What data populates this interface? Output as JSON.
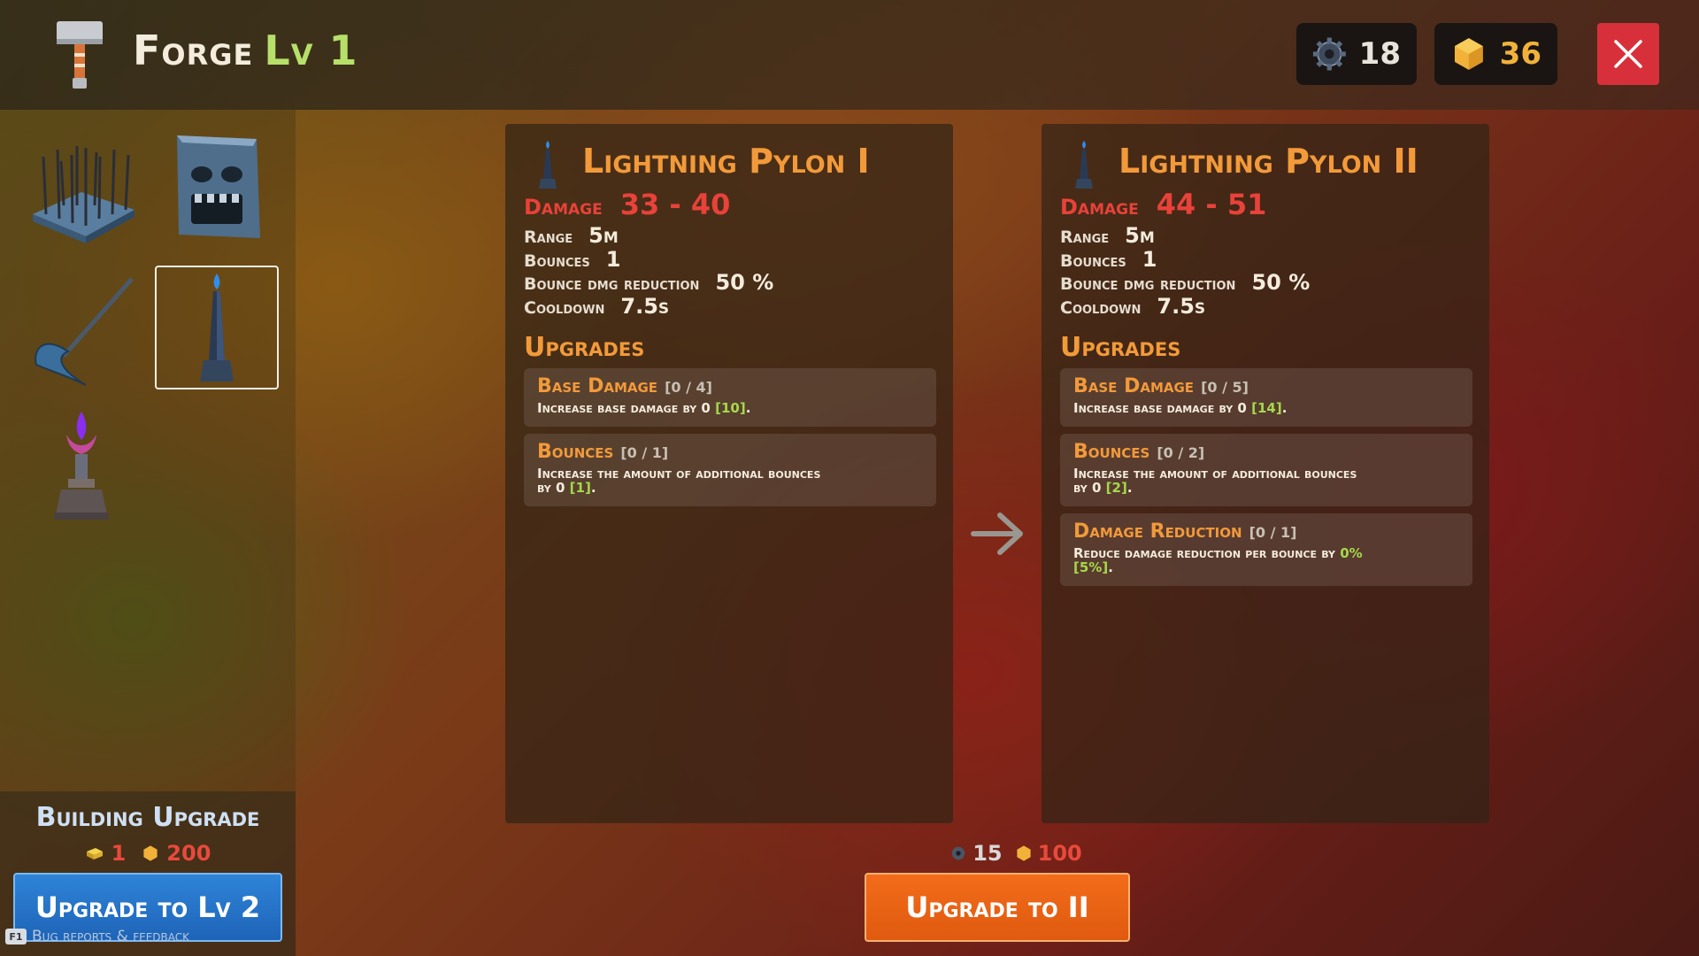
{
  "header": {
    "title": "Forge",
    "level": "Lv 1",
    "gears": "18",
    "gold": "36"
  },
  "sidebar": {
    "items": [
      {
        "icon": "spike-trap-icon",
        "selected": false
      },
      {
        "icon": "stone-face-trap-icon",
        "selected": false
      },
      {
        "icon": "scythe-trap-icon",
        "selected": false
      },
      {
        "icon": "lightning-pylon-icon",
        "selected": true
      },
      {
        "icon": "crystal-brazier-icon",
        "selected": false
      }
    ],
    "building_upgrade": {
      "title": "Building Upgrade",
      "cost_bars": "1",
      "cost_gold": "200",
      "button": "Upgrade to Lv 2"
    },
    "bug_link": "Bug reports & feedback",
    "bug_key": "F1"
  },
  "current": {
    "name": "Lightning Pylon I",
    "damage_label": "Damage",
    "damage": "33 - 40",
    "range_label": "Range",
    "range": "5m",
    "bounces_label": "Bounces",
    "bounces": "1",
    "reduction_label": "Bounce dmg reduction",
    "reduction": "50 %",
    "cooldown_label": "Cooldown",
    "cooldown": "7.5s",
    "upgrades_heading": "Upgrades",
    "upgrades": [
      {
        "name": "Base Damage",
        "count": "[0 / 4]",
        "desc": "Increase base damage by ",
        "cur": "0",
        "next": "[10]",
        "end": "."
      },
      {
        "name": "Bounces",
        "count": "[0 / 1]",
        "desc": "Increase the amount of additional bounces by ",
        "cur": "0",
        "next": "[1]",
        "end": "."
      }
    ]
  },
  "next": {
    "name": "Lightning Pylon II",
    "damage_label": "Damage",
    "damage": "44 - 51",
    "range_label": "Range",
    "range": "5m",
    "bounces_label": "Bounces",
    "bounces": "1",
    "reduction_label": "Bounce dmg reduction",
    "reduction": "50 %",
    "cooldown_label": "Cooldown",
    "cooldown": "7.5s",
    "upgrades_heading": "Upgrades",
    "upgrades": [
      {
        "name": "Base Damage",
        "count": "[0 / 5]",
        "desc": "Increase base damage by ",
        "cur": "0",
        "next": "[14]",
        "end": "."
      },
      {
        "name": "Bounces",
        "count": "[0 / 2]",
        "desc": "Increase the amount of additional bounces by ",
        "cur": "0",
        "next": "[2]",
        "end": "."
      },
      {
        "name": "Damage Reduction",
        "count": "[0 / 1]",
        "desc": "Reduce damage reduction per bounce by ",
        "cur": "0%",
        "next": "[5%]",
        "end": "."
      }
    ]
  },
  "upgrade_cost": {
    "gears": "15",
    "gold": "100"
  },
  "upgrade_button": "Upgrade to II",
  "colors": {
    "accent_orange": "#f29a3a",
    "damage_red": "#e8423a",
    "level_green": "#b6e06a",
    "close_red": "#d8303a",
    "button_blue": "#1e64b8",
    "button_orange": "#e05a10"
  }
}
